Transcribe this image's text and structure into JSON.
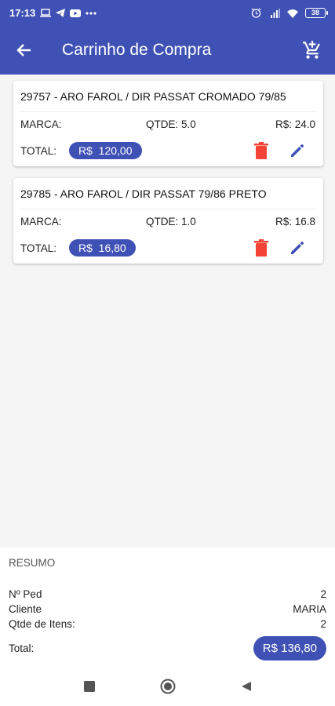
{
  "status_bar": {
    "time": "17:13",
    "battery": "38"
  },
  "app_bar": {
    "title": "Carrinho de Compra",
    "back_icon": "arrow-back-icon",
    "cart_icon": "add-shopping-cart-icon"
  },
  "items": [
    {
      "product": "29757 - ARO FAROL / DIR PASSAT CROMADO 79/85",
      "marca_label": "MARCA:",
      "qtde": "QTDE: 5.0",
      "preco": "R$: 24.0",
      "total_label": "TOTAL:",
      "total": "R$  120,00"
    },
    {
      "product": "29785 - ARO FAROL / DIR PASSAT 79/86  PRETO",
      "marca_label": "MARCA:",
      "qtde": "QTDE: 1.0",
      "preco": "R$: 16.8",
      "total_label": "TOTAL:",
      "total": "R$  16,80"
    }
  ],
  "resumo": {
    "title": "RESUMO",
    "num_ped_label": "Nº Ped",
    "num_ped": "2",
    "cliente_label": "Cliente",
    "cliente": "MARIA",
    "qtde_label": "Qtde de Itens:",
    "qtde": "2",
    "total_label": "Total:",
    "total": "R$ 136,80"
  },
  "colors": {
    "primary": "#3f51b5",
    "delete": "#f44336"
  }
}
